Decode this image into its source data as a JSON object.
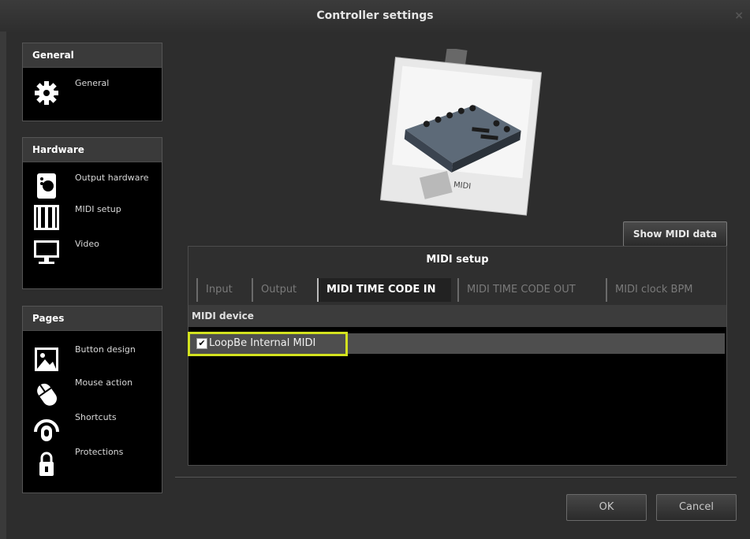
{
  "window": {
    "title": "Controller settings",
    "close_glyph": "×"
  },
  "sidebar": {
    "groups": [
      {
        "header": "General",
        "items": [
          {
            "label": "General",
            "icon": "gear-icon"
          }
        ]
      },
      {
        "header": "Hardware",
        "items": [
          {
            "label": "Output hardware",
            "icon": "speaker-icon"
          },
          {
            "label": "MIDI setup",
            "icon": "piano-keys-icon"
          },
          {
            "label": "Video",
            "icon": "monitor-icon"
          }
        ]
      },
      {
        "header": "Pages",
        "items": [
          {
            "label": "Button design",
            "icon": "image-icon"
          },
          {
            "label": "Mouse action",
            "icon": "mouse-icon"
          },
          {
            "label": "Shortcuts",
            "icon": "shortcut-icon"
          },
          {
            "label": "Protections",
            "icon": "lock-icon"
          }
        ]
      }
    ]
  },
  "photo": {
    "caption": "MIDI"
  },
  "show_midi_button": "Show MIDI data",
  "panel": {
    "title": "MIDI setup",
    "tabs": [
      {
        "label": "Input",
        "active": false
      },
      {
        "label": "Output",
        "active": false
      },
      {
        "label": "MIDI TIME CODE IN",
        "active": true
      },
      {
        "label": "MIDI TIME CODE OUT",
        "active": false
      },
      {
        "label": "MIDI clock BPM",
        "active": false
      }
    ],
    "list_header": "MIDI device",
    "rows": [
      {
        "label": "LoopBe Internal MIDI",
        "checked": true,
        "check_glyph": "✔"
      }
    ]
  },
  "footer": {
    "ok_label": "OK",
    "cancel_label": "Cancel"
  },
  "colors": {
    "highlight": "#d3e21f",
    "background": "#2d2d2d"
  }
}
